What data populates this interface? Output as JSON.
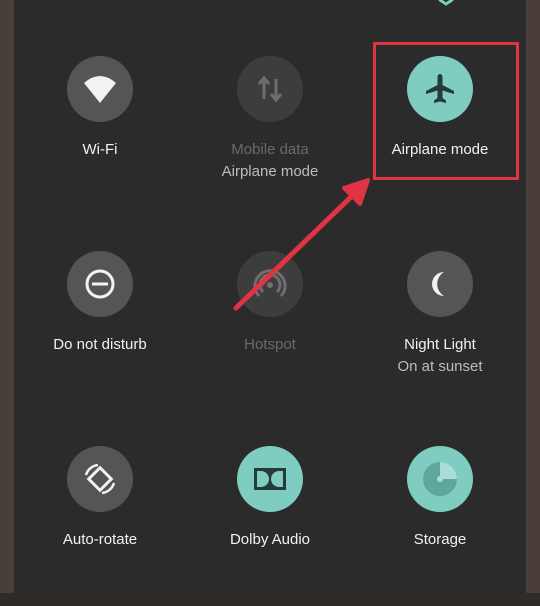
{
  "tiles": [
    {
      "key": "wifi",
      "label": "Wi-Fi",
      "sub": "",
      "state": "off",
      "icon": "wifi-icon"
    },
    {
      "key": "mobile",
      "label": "Mobile data",
      "sub": "Airplane mode",
      "state": "disabled",
      "icon": "mobile-data-icon"
    },
    {
      "key": "airplane",
      "label": "Airplane mode",
      "sub": "",
      "state": "on",
      "icon": "airplane-icon"
    },
    {
      "key": "dnd",
      "label": "Do not disturb",
      "sub": "",
      "state": "off",
      "icon": "do-not-disturb-icon"
    },
    {
      "key": "hotspot",
      "label": "Hotspot",
      "sub": "",
      "state": "disabled",
      "icon": "hotspot-icon"
    },
    {
      "key": "night",
      "label": "Night Light",
      "sub": "On at sunset",
      "state": "off",
      "icon": "moon-icon"
    },
    {
      "key": "rotate",
      "label": "Auto-rotate",
      "sub": "",
      "state": "off",
      "icon": "auto-rotate-icon"
    },
    {
      "key": "dolby",
      "label": "Dolby Audio",
      "sub": "",
      "state": "on",
      "icon": "dolby-icon"
    },
    {
      "key": "storage",
      "label": "Storage",
      "sub": "",
      "state": "on",
      "icon": "storage-icon"
    }
  ],
  "colors": {
    "panel": "#2b2b2b",
    "active": "#7fcdc1",
    "inactive": "#555555",
    "disabled": "#3d3d3d",
    "annotation": "#e03444"
  }
}
